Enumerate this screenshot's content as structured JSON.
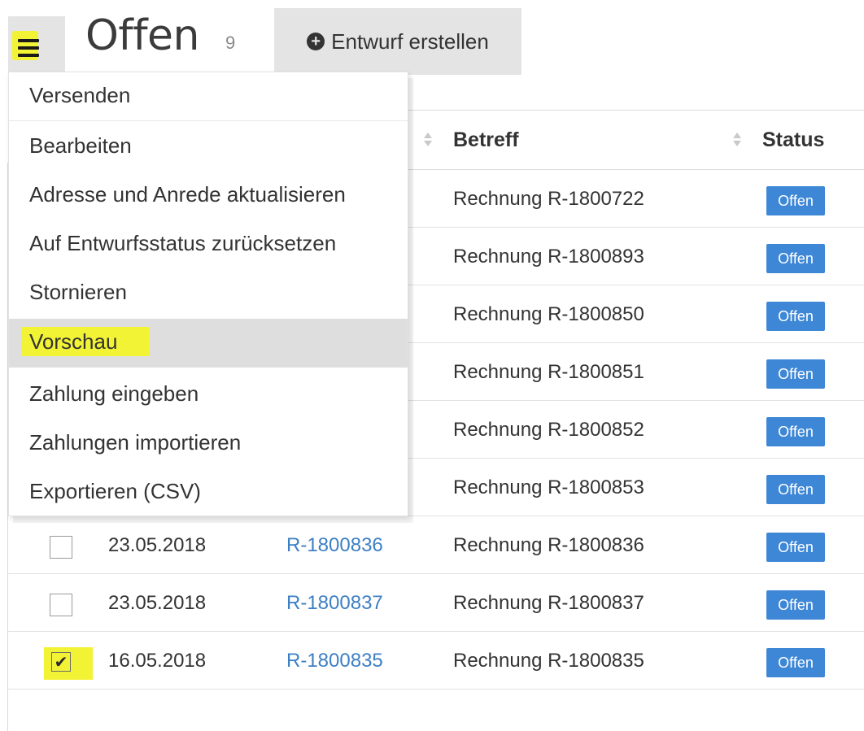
{
  "header": {
    "title": "Offen",
    "count": "9",
    "create_label": "Entwurf erstellen"
  },
  "menu": {
    "items": [
      {
        "label": "Versenden"
      },
      {
        "label": "Bearbeiten"
      },
      {
        "label": "Adresse und Anrede aktualisieren"
      },
      {
        "label": "Auf Entwurfsstatus zurücksetzen"
      },
      {
        "label": "Stornieren"
      },
      {
        "label": "Vorschau"
      },
      {
        "label": "Zahlung eingeben"
      },
      {
        "label": "Zahlungen importieren"
      },
      {
        "label": "Exportieren (CSV)"
      }
    ],
    "active_item": "Vorschau"
  },
  "table": {
    "columns": {
      "subject": "Betreff",
      "status": "Status"
    },
    "rows": [
      {
        "date": "",
        "number": "",
        "subject": "Rechnung R-1800722",
        "status": "Offen",
        "checked": false
      },
      {
        "date": "",
        "number": "",
        "subject": "Rechnung R-1800893",
        "status": "Offen",
        "checked": false
      },
      {
        "date": "",
        "number": "",
        "subject": "Rechnung R-1800850",
        "status": "Offen",
        "checked": false
      },
      {
        "date": "",
        "number": "",
        "subject": "Rechnung R-1800851",
        "status": "Offen",
        "checked": false
      },
      {
        "date": "",
        "number": "",
        "subject": "Rechnung R-1800852",
        "status": "Offen",
        "checked": false
      },
      {
        "date": "",
        "number": "",
        "subject": "Rechnung R-1800853",
        "status": "Offen",
        "checked": false
      },
      {
        "date": "23.05.2018",
        "number": "R-1800836",
        "subject": "Rechnung R-1800836",
        "status": "Offen",
        "checked": false
      },
      {
        "date": "23.05.2018",
        "number": "R-1800837",
        "subject": "Rechnung R-1800837",
        "status": "Offen",
        "checked": false
      },
      {
        "date": "16.05.2018",
        "number": "R-1800835",
        "subject": "Rechnung R-1800835",
        "status": "Offen",
        "checked": true
      }
    ]
  },
  "colors": {
    "status_badge": "#3d87d6",
    "link": "#3d7fc4",
    "highlight": "#f3f335",
    "button_bg": "#e4e4e4"
  }
}
